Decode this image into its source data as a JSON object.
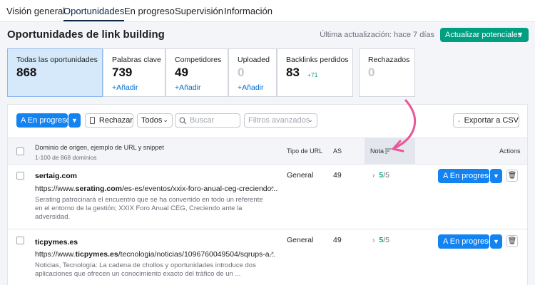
{
  "nav": {
    "tabs": [
      "Visión general",
      "Oportunidades",
      "En progreso",
      "Supervisión",
      "Información"
    ]
  },
  "header": {
    "title": "Oportunidades de link building",
    "updated": "Última actualización: hace 7 días",
    "update_button": "Actualizar potenciales"
  },
  "cards": [
    {
      "label": "Todas las oportunidades",
      "value": "868"
    },
    {
      "label": "Palabras clave",
      "value": "739",
      "add": "+Añadir"
    },
    {
      "label": "Competidores",
      "value": "49",
      "add": "+Añadir"
    },
    {
      "label": "Uploaded",
      "value": "0",
      "add": "+Añadir"
    },
    {
      "label": "Backlinks perdidos",
      "value": "83",
      "delta": "+71"
    },
    {
      "label": "Rechazados",
      "value": "0"
    }
  ],
  "toolbar": {
    "in_progress": "A En progreso",
    "reject": "Rechazar",
    "select_all": "Todos",
    "search_placeholder": "Buscar",
    "advanced_filters": "Filtros avanzados",
    "export": "Exportar a CSV"
  },
  "table": {
    "col_source": "Dominio de origen, ejemplo de URL y snippet",
    "col_source_sub": "1-100 de 868 dominios",
    "col_url_type": "Tipo de URL",
    "col_as": "AS",
    "col_rating": "Nota",
    "col_actions": "Actions",
    "rows": [
      {
        "domain": "sertaig.com",
        "url_pre": "https://www.",
        "url_bold": "serating.com",
        "url_post": "/es-es/eventos/xxix-foro-anual-ceg-creciendo...",
        "snippet": "Serating patrocinará el encuentro que se ha convertido en todo un referente en el entorno de la gestión; XXIX Foro Anual CEG, Creciendo ante la adversidad.",
        "url_type": "General",
        "as": "49",
        "rating_value": "5",
        "rating_max": "/5",
        "action": "A En progreso"
      },
      {
        "domain": "ticpymes.es",
        "url_pre": "https://www.",
        "url_bold": "ticpymes.es",
        "url_post": "/tecnologia/noticias/1096760049504/sqrups-a...",
        "snippet": "Noticias, Tecnología: La cadena de chollos y oportunidades introduce dos aplicaciones que ofrecen un conocimiento exacto del tráfico de un ...",
        "url_type": "General",
        "as": "49",
        "rating_value": "5",
        "rating_max": "/5",
        "action": "A En progreso"
      }
    ]
  },
  "colors": {
    "accent_green": "#009f81",
    "primary_blue": "#1383f2",
    "annotation_pink": "#e8579a"
  }
}
